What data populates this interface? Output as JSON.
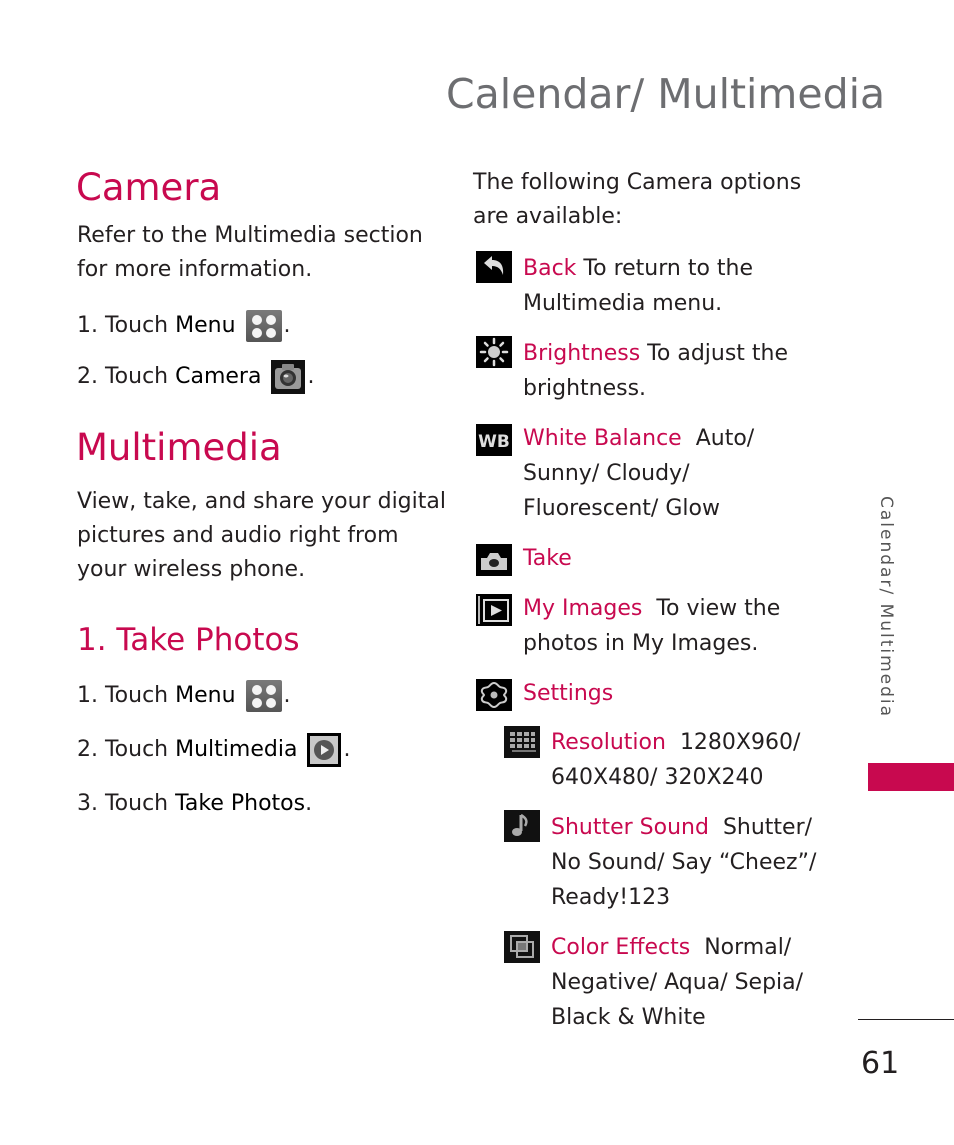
{
  "page": {
    "title": "Calendar/ Multimedia",
    "side_tab": "Calendar/ Multimedia",
    "page_number": "61",
    "accent_color": "#c8094f"
  },
  "camera": {
    "heading": "Camera",
    "intro_line1": "Refer to the Multimedia section",
    "intro_line2": "for more information.",
    "steps": [
      {
        "prefix": "1. Touch ",
        "target": "Menu",
        "icon": "menu-grid-icon",
        "suffix": "."
      },
      {
        "prefix": "2. Touch ",
        "target": "Camera",
        "icon": "camera-icon",
        "suffix": "."
      }
    ]
  },
  "multimedia": {
    "heading": "Multimedia",
    "intro_line1": "View, take, and share your digital",
    "intro_line2": "pictures and audio right from",
    "intro_line3": "your wireless phone."
  },
  "take_photos": {
    "heading": "1. Take Photos",
    "steps": [
      {
        "prefix": "1. Touch ",
        "target": "Menu",
        "icon": "menu-grid-icon",
        "suffix": "."
      },
      {
        "prefix": "2. Touch ",
        "target": "Multimedia",
        "icon": "multimedia-icon",
        "suffix": "."
      },
      {
        "prefix": "3. Touch ",
        "target": "Take Photos",
        "suffix": "."
      }
    ]
  },
  "options": {
    "intro_line1": "The following Camera options",
    "intro_line2": "are available:",
    "items": [
      {
        "label": "Back",
        "icon": "back-arrow-icon",
        "lines": [
          " To return to the",
          "Multimedia menu."
        ]
      },
      {
        "label": "Brightness",
        "icon": "brightness-sun-icon",
        "lines": [
          " To adjust the",
          "brightness."
        ]
      },
      {
        "label": "White Balance",
        "icon": "white-balance-icon",
        "lines": [
          "  Auto/",
          "Sunny/ Cloudy/",
          "Fluorescent/ Glow"
        ]
      },
      {
        "label": "Take",
        "icon": "take-camera-icon",
        "lines": [
          ""
        ]
      },
      {
        "label": "My Images",
        "icon": "my-images-play-icon",
        "lines": [
          "  To view the",
          "photos in My Images."
        ]
      },
      {
        "label": "Settings",
        "icon": "settings-gear-icon",
        "lines": [
          ""
        ]
      }
    ],
    "settings_items": [
      {
        "label": "Resolution",
        "icon": "resolution-grid-icon",
        "lines": [
          "  1280X960/",
          "640X480/ 320X240"
        ]
      },
      {
        "label": "Shutter Sound",
        "icon": "music-note-icon",
        "lines": [
          "  Shutter/",
          "No Sound/ Say “Cheez”/",
          "Ready!123"
        ]
      },
      {
        "label": "Color Effects",
        "icon": "color-effects-icon",
        "lines": [
          "  Normal/",
          "Negative/ Aqua/ Sepia/",
          "Black & White"
        ]
      }
    ]
  }
}
